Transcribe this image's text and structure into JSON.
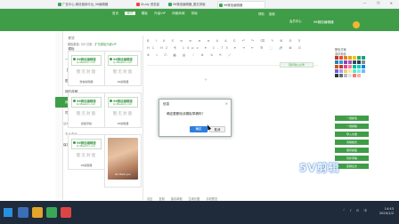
{
  "browser": {
    "tabs": [
      {
        "label": "广告中心-微信营销平台_96编辑器",
        "active": false
      },
      {
        "label": "Study 首发星",
        "active": false
      },
      {
        "label": "96微信编辑器_图文排版",
        "active": false
      },
      {
        "label": "96微信编辑器",
        "active": true
      }
    ],
    "window_controls": "— ❐ ✕"
  },
  "topnav": {
    "menu": [
      "首页",
      "样式",
      "模板",
      "升级VIP",
      "风格商城",
      "排版"
    ],
    "current": "样式",
    "util": [
      "帮助",
      "客服"
    ],
    "user": "会员中心",
    "brand": "96微信编辑器"
  },
  "sidebar": {
    "items": [
      {
        "label": "样式",
        "active": false
      },
      {
        "label": "模板",
        "active": false
      },
      {
        "label": "一键排版",
        "active": false
      },
      {
        "label": "剪贴板",
        "active": false
      },
      {
        "label": "图片素材",
        "active": false
      },
      {
        "label": "我的收藏",
        "active": false
      },
      {
        "label": "我的草稿",
        "active": true
      },
      {
        "label": "同步草稿",
        "active": false
      },
      {
        "label": "公众号管理",
        "active": false
      },
      {
        "label": "个人中心",
        "active": false
      },
      {
        "label": "保存到样式",
        "active": false
      }
    ]
  },
  "templates": {
    "tip_prefix": "模板数量: 5/5 已用 · ",
    "tip_link": "扩充模板升级VIP",
    "logo_title": "96微信编辑器",
    "logo_url": "bj.96weixin.com",
    "no_cover": "暂无封面",
    "cards": [
      {
        "caption": "微信编辑器",
        "type": "logo"
      },
      {
        "caption": "96编辑器",
        "type": "logo"
      },
      {
        "caption": "模板草稿",
        "type": "logo"
      },
      {
        "caption": "96编辑器",
        "type": "logo"
      },
      {
        "caption": "96编辑器",
        "type": "logo"
      },
      {
        "caption": "",
        "type": "photo",
        "subtitle": "No thank you"
      }
    ]
  },
  "editor": {
    "toolbar_rows": [
      "B I U S ≡ ≡ ≡ ≡ A A ⎘ ↶ ↷ ⌫ ✎ ⊞ ⊟ ⚲",
      "H1 H2 ¶ 14px ▾ 1.75 ▾ ⇥ ⇤ ☰ ⬚ 🔗 ⊠ ⊡",
      "⊕ ⌗ ⎚ ▦ ▤ ♢ ⊗ ⇲ ⇱ ⤢"
    ],
    "sync_button": "同步到公众号",
    "bottom": [
      "清空",
      "复制",
      "保存草稿",
      "生成长图",
      "手机预览"
    ]
  },
  "palette": {
    "title1": "配色方案",
    "title2": "选中颜色",
    "rows": [
      [
        "#c0392b",
        "#e74c3c",
        "#e67e22",
        "#f39c12",
        "#f1c40f",
        "#27ae60",
        "#16a085"
      ],
      [
        "#2980b9",
        "#3498db",
        "#8e44ad",
        "#9b59b6",
        "#34495e",
        "#2c3e50",
        "#7f8c8d"
      ],
      [
        "#d35400",
        "#c0392b",
        "#e84393",
        "#fd79a8",
        "#00b894",
        "#00cec9",
        "#0984e3"
      ],
      [
        "#6c5ce7",
        "#a29bfe",
        "#fdcb6e",
        "#ffeaa7",
        "#55efc4",
        "#81ecec",
        "#74b9ff"
      ],
      [
        "#2d3436",
        "#636e72",
        "#b2bec3",
        "#dfe6e9",
        "#ff7675",
        "#fab1a0",
        "#ffffff"
      ]
    ],
    "buttons": [
      "一键换色",
      "一键排版",
      "导入文章",
      "清除格式",
      "保存模板",
      "同步草稿",
      "复制全文"
    ]
  },
  "dialog": {
    "title": "信息",
    "close": "✕",
    "message": "确定要删除该模板草稿吗？",
    "ok": "确定",
    "cancel": "取消"
  },
  "watermark": "5V剪辑",
  "taskbar": {
    "time": "14:43",
    "date": "2020/1/2",
    "tray": "⌃ ♪ ⊡ 中"
  }
}
